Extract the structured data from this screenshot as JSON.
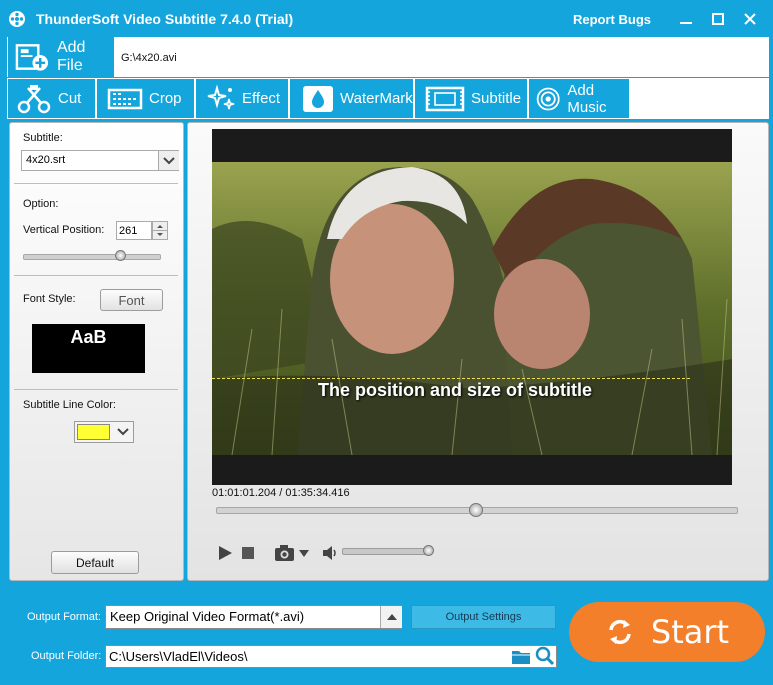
{
  "window": {
    "title": "ThunderSoft Video Subtitle 7.4.0 (Trial)",
    "report_bugs": "Report Bugs"
  },
  "file": {
    "add_file_label": "Add File",
    "path": "G:\\4x20.avi"
  },
  "tabs": [
    {
      "label": "Cut",
      "icon": "scissors-icon"
    },
    {
      "label": "Crop",
      "icon": "crop-icon"
    },
    {
      "label": "Effect",
      "icon": "sparkle-icon"
    },
    {
      "label": "WaterMark",
      "icon": "drop-icon"
    },
    {
      "label": "Subtitle",
      "icon": "subtitle-icon"
    },
    {
      "label": "Add Music",
      "icon": "music-icon"
    }
  ],
  "subtitle_panel": {
    "subtitle_label": "Subtitle:",
    "subtitle_file": "4x20.srt",
    "option_label": "Option:",
    "vertical_position_label": "Vertical Position:",
    "vertical_position_value": "261",
    "vertical_position_fraction": 0.72,
    "font_style_label": "Font Style:",
    "font_button": "Font",
    "font_preview": "AaB",
    "line_color_label": "Subtitle Line Color:",
    "line_color": "#ffff33",
    "default_button": "Default"
  },
  "player": {
    "subtitle_preview_text": "The position and size of subtitle",
    "timecode": "01:01:01.204 / 01:35:34.416",
    "progress_fraction": 0.5,
    "volume_fraction": 1.0
  },
  "output": {
    "format_label": "Output Format:",
    "format_value": "Keep Original Video Format(*.avi)",
    "settings_button": "Output Settings",
    "folder_label": "Output Folder:",
    "folder_value": "C:\\Users\\VladEl\\Videos\\",
    "start_button": "Start"
  },
  "colors": {
    "accent": "#14a5dc",
    "start": "#f47f2a"
  }
}
